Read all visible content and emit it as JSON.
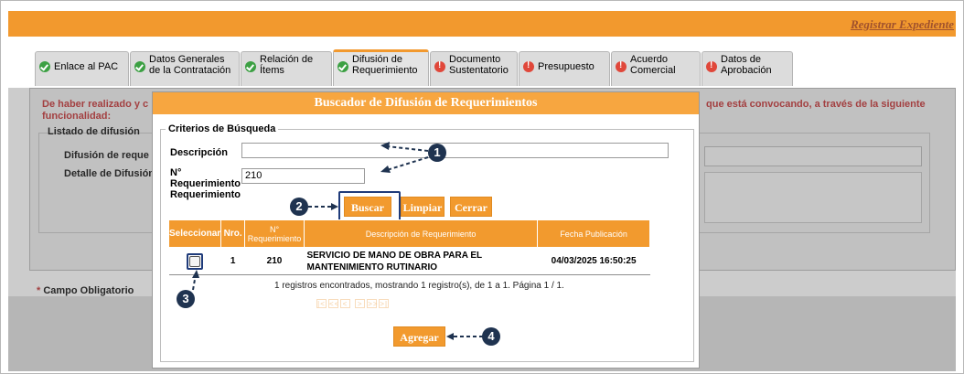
{
  "header": {
    "register_link": "Registrar Expediente"
  },
  "tabs": [
    {
      "label": "Enlace al PAC",
      "status": "ok"
    },
    {
      "label": "Datos Generales de la Contratación",
      "status": "ok"
    },
    {
      "label": "Relación de Ítems",
      "status": "ok"
    },
    {
      "label": "Difusión de Requerimiento",
      "status": "ok",
      "active": true
    },
    {
      "label": "Documento Sustentatorio",
      "status": "warn"
    },
    {
      "label": "Presupuesto",
      "status": "warn"
    },
    {
      "label": "Acuerdo Comercial",
      "status": "warn"
    },
    {
      "label": "Datos de Aprobación",
      "status": "warn"
    }
  ],
  "background": {
    "warning_left": "De haber realizado y c",
    "warning_left_2": "funcionalidad:",
    "warning_right": "que está convocando, a través de la siguiente",
    "listado": "Listado de difusión",
    "difusion_label": "Difusión de reque",
    "detalle_label": "Detalle de Difusión",
    "required_star": "*",
    "required_note": "Campo Obligatorio"
  },
  "modal": {
    "title": "Buscador de Difusión de Requerimientos",
    "criteria_legend": "Criterios de Búsqueda",
    "descripcion_label": "Descripción",
    "descripcion_value": "",
    "nro_req_label_1": "N°",
    "nro_req_label_2": "Requerimiento",
    "nro_req_value": "210",
    "buttons": {
      "buscar": "Buscar",
      "limpiar": "Limpiar",
      "cerrar": "Cerrar",
      "agregar": "Agregar"
    },
    "table": {
      "headers": [
        "Seleccionar",
        "Nro.",
        "N° Requerimiento",
        "Descripción de Requerimiento",
        "Fecha Publicación"
      ],
      "rows": [
        {
          "nro": "1",
          "requerimiento": "210",
          "descripcion": "SERVICIO DE MANO DE OBRA PARA EL MANTENIMIENTO RUTINARIO",
          "fecha": "04/03/2025 16:50:25",
          "selected": false
        }
      ]
    },
    "records_info": "1 registros encontrados, mostrando 1 registro(s), de 1 a 1. Página 1 / 1."
  },
  "callouts": [
    "1",
    "2",
    "3",
    "4"
  ],
  "colors": {
    "accent": "#f29a2e",
    "callout": "#1f3350",
    "warning_text": "#c0282a"
  }
}
